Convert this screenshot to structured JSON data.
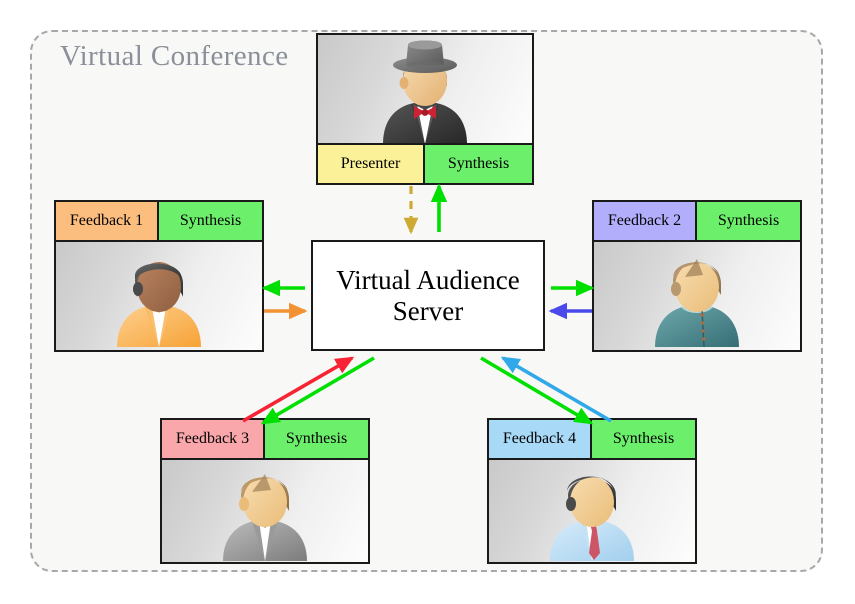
{
  "frame": {
    "title": "Virtual Conference",
    "border_style": "dashed",
    "border_color": "#a8a8a8",
    "background": "#f8f8f7"
  },
  "server": {
    "name": "virtual-audience-server",
    "label_line1": "Virtual Audience",
    "label_line2": "Server",
    "label": "Virtual Audience Server",
    "background": "#ffffff",
    "border_color": "#1a1a1a"
  },
  "participants": [
    {
      "id": "presenter",
      "role_label": "Presenter",
      "synthesis_label": "Synthesis",
      "role_color": "#fbf198",
      "synthesis_color": "#6cf06c",
      "avatar": "presenter-avatar",
      "label_position": "bottom"
    },
    {
      "id": "feedback-1",
      "role_label": "Feedback 1",
      "synthesis_label": "Synthesis",
      "role_color": "#fcbe7f",
      "synthesis_color": "#6cf06c",
      "avatar": "audience-avatar-1",
      "label_position": "top"
    },
    {
      "id": "feedback-2",
      "role_label": "Feedback 2",
      "synthesis_label": "Synthesis",
      "role_color": "#b3aefb",
      "synthesis_color": "#6cf06c",
      "avatar": "audience-avatar-2",
      "label_position": "top"
    },
    {
      "id": "feedback-3",
      "role_label": "Feedback 3",
      "synthesis_label": "Synthesis",
      "role_color": "#faa7ab",
      "synthesis_color": "#6cf06c",
      "avatar": "audience-avatar-3",
      "label_position": "top"
    },
    {
      "id": "feedback-4",
      "role_label": "Feedback 4",
      "synthesis_label": "Synthesis",
      "role_color": "#a8daf7",
      "synthesis_color": "#6cf06c",
      "avatar": "audience-avatar-4",
      "label_position": "top"
    }
  ],
  "connections": [
    {
      "id": "presenter-to-server",
      "from": "presenter",
      "to": "server",
      "color": "#ccaa33",
      "style": "dashed"
    },
    {
      "id": "server-to-presenter",
      "from": "server",
      "to": "presenter",
      "color": "#00e000",
      "style": "solid"
    },
    {
      "id": "server-to-feedback-1",
      "from": "server",
      "to": "feedback-1",
      "color": "#00e000",
      "style": "solid"
    },
    {
      "id": "feedback-1-to-server",
      "from": "feedback-1",
      "to": "server",
      "color": "#f29233",
      "style": "solid"
    },
    {
      "id": "server-to-feedback-2",
      "from": "server",
      "to": "feedback-2",
      "color": "#00e000",
      "style": "solid"
    },
    {
      "id": "feedback-2-to-server",
      "from": "feedback-2",
      "to": "server",
      "color": "#4a4aea",
      "style": "solid"
    },
    {
      "id": "server-to-feedback-3",
      "from": "server",
      "to": "feedback-3",
      "color": "#00e000",
      "style": "solid"
    },
    {
      "id": "feedback-3-to-server",
      "from": "feedback-3",
      "to": "server",
      "color": "#f62434",
      "style": "solid"
    },
    {
      "id": "server-to-feedback-4",
      "from": "server",
      "to": "feedback-4",
      "color": "#00e000",
      "style": "solid"
    },
    {
      "id": "feedback-4-to-server",
      "from": "feedback-4",
      "to": "server",
      "color": "#31a8e8",
      "style": "solid"
    }
  ],
  "avatar_colors": {
    "presenter": {
      "hat": "#777777",
      "hair": "#b58a5c",
      "skin": "#f0c88d",
      "body": "#3c3c3c",
      "shirt": "#ffffff",
      "accent": "#cc2233"
    },
    "audience_1": {
      "hair": "#4a4a4a",
      "skin": "#a8714e",
      "body": "#fcb24d",
      "shirt": "#ffffff",
      "accent": "#fcb24d"
    },
    "audience_2": {
      "hair": "#a98a63",
      "skin": "#f3cb93",
      "body": "#4d8e94",
      "shirt": "#4d8e94",
      "accent": "#b56a3a"
    },
    "audience_3": {
      "hair": "#b08c5b",
      "skin": "#f3cb93",
      "body": "#9a9a9a",
      "shirt": "#ffffff",
      "accent": "#9a9a9a"
    },
    "audience_4": {
      "hair": "#3f3f3f",
      "skin": "#f0c88d",
      "body": "#b9dcf3",
      "shirt": "#ffffff",
      "accent": "#cc5566"
    }
  }
}
